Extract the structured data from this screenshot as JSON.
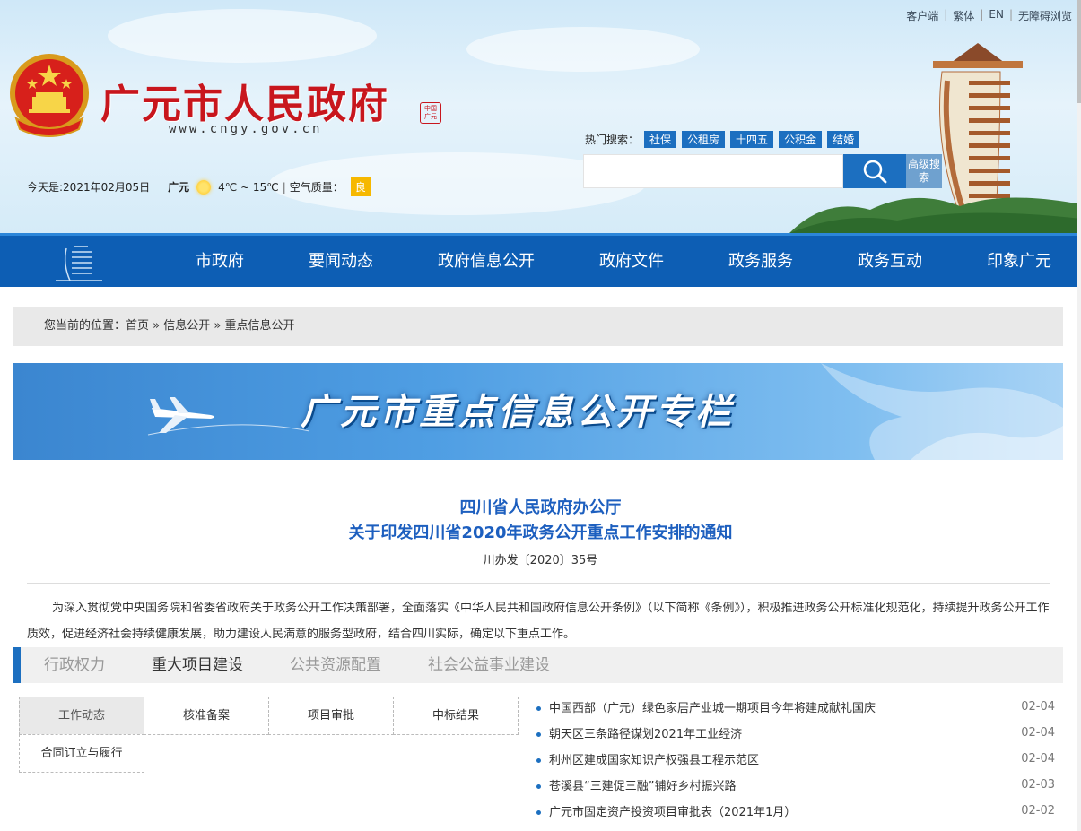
{
  "header": {
    "top_links": [
      "客户端",
      "繁体",
      "EN",
      "无障碍浏览"
    ],
    "site_title": "广元市人民政府",
    "seal_text": "中国广元",
    "site_url": "www.cngy.gov.cn",
    "date_text": "今天是:2021年02月05日",
    "weather_city": "广元",
    "weather_temp": "4℃ ~ 15℃",
    "air_quality_label": "空气质量：",
    "air_quality_value": "良",
    "hot_search_label": "热门搜索：",
    "hot_tags": [
      "社保",
      "公租房",
      "十四五",
      "公积金",
      "结婚"
    ],
    "search_placeholder": "",
    "advanced_search_label": "高级搜索"
  },
  "nav": {
    "items": [
      "市政府",
      "要闻动态",
      "政府信息公开",
      "政府文件",
      "政务服务",
      "政务互动",
      "印象广元"
    ]
  },
  "breadcrumb": {
    "prefix": "您当前的位置：",
    "items": [
      "首页",
      "信息公开",
      "重点信息公开"
    ],
    "separator": " » "
  },
  "banner": {
    "title": "广元市重点信息公开专栏"
  },
  "article": {
    "title_line1": "四川省人民政府办公厅",
    "title_line2": "关于印发四川省2020年政务公开重点工作安排的通知",
    "doc_number": "川办发〔2020〕35号",
    "body": "为深入贯彻党中央国务院和省委省政府关于政务公开工作决策部署，全面落实《中华人民共和国政府信息公开条例》（以下简称《条例》），积极推进政务公开标准化规范化，持续提升政务公开工作质效，促进经济社会持续健康发展，助力建设人民满意的服务型政府，结合四川实际，确定以下重点工作。"
  },
  "tabs": {
    "items": [
      "行政权力",
      "重大项目建设",
      "公共资源配置",
      "社会公益事业建设"
    ],
    "active_index": 1
  },
  "subtabs": {
    "row1": [
      "工作动态",
      "核准备案",
      "项目审批",
      "中标结果"
    ],
    "row2": [
      "合同订立与履行"
    ],
    "active": "工作动态"
  },
  "news": [
    {
      "title": "中国西部（广元）绿色家居产业城一期项目今年将建成献礼国庆",
      "date": "02-04"
    },
    {
      "title": "朝天区三条路径谋划2021年工业经济",
      "date": "02-04"
    },
    {
      "title": "利州区建成国家知识产权强县工程示范区",
      "date": "02-04"
    },
    {
      "title": "苍溪县“三建促三融”铺好乡村振兴路",
      "date": "02-03"
    },
    {
      "title": "广元市固定资产投资项目审批表（2021年1月）",
      "date": "02-02"
    }
  ],
  "colors": {
    "nav_blue": "#0d5eb4",
    "accent_blue": "#1c6fc0",
    "title_red": "#c8161d",
    "aq_yellow": "#f6b800"
  }
}
